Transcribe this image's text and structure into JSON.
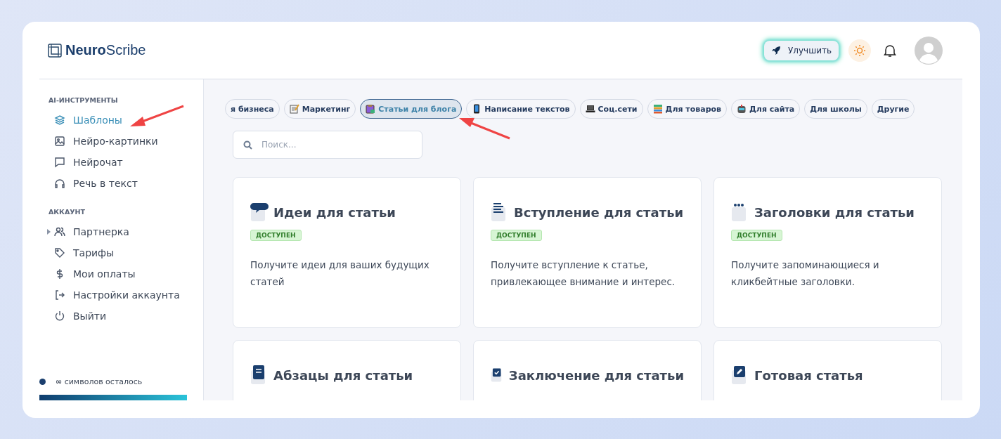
{
  "brand": {
    "bold": "Neuro",
    "light": "Scribe"
  },
  "header": {
    "upgrade_label": "Улучшить"
  },
  "sidebar": {
    "sections": [
      {
        "title": "AI-ИНСТРУМЕНТЫ",
        "items": [
          {
            "label": "Шаблоны",
            "selected": true
          },
          {
            "label": "Нейро-картинки",
            "selected": false
          },
          {
            "label": "Нейрочат",
            "selected": false
          },
          {
            "label": "Речь в текст",
            "selected": false
          }
        ]
      },
      {
        "title": "АККАУНТ",
        "items": [
          {
            "label": "Партнерка",
            "selected": false,
            "expanded": false
          },
          {
            "label": "Тарифы",
            "selected": false
          },
          {
            "label": "Мои оплаты",
            "selected": false
          },
          {
            "label": "Настройки аккаунта",
            "selected": false
          },
          {
            "label": "Выйти",
            "selected": false
          }
        ]
      }
    ],
    "credits": {
      "amount": "∞",
      "label": "символов осталось",
      "level": 1
    }
  },
  "categories": [
    {
      "label": "я бизнеса",
      "selected": false
    },
    {
      "label": "Маркетинг",
      "selected": false
    },
    {
      "label": "Статьи для блога",
      "selected": true
    },
    {
      "label": "Написание текстов",
      "selected": false
    },
    {
      "label": "Соц.сети",
      "selected": false
    },
    {
      "label": "Для товаров",
      "selected": false
    },
    {
      "label": "Для сайта",
      "selected": false
    },
    {
      "label": "Для школы",
      "selected": false
    },
    {
      "label": "Другие",
      "selected": false
    }
  ],
  "search": {
    "placeholder": "Поиск..."
  },
  "cards": [
    {
      "title": "Идеи для статьи",
      "badge": "ДОСТУПЕН",
      "description": "Получите идеи для ваших будущих статей"
    },
    {
      "title": "Вступление для статьи",
      "badge": "ДОСТУПЕН",
      "description": "Получите вступление к статье, привлекающее внимание и интерес."
    },
    {
      "title": "Заголовки для статьи",
      "badge": "ДОСТУПЕН",
      "description": "Получите запоминающиеся и кликбейтные заголовки."
    },
    {
      "title": "Абзацы для статьи"
    },
    {
      "title": "Заключение для статьи"
    },
    {
      "title": "Готовая статья"
    }
  ]
}
